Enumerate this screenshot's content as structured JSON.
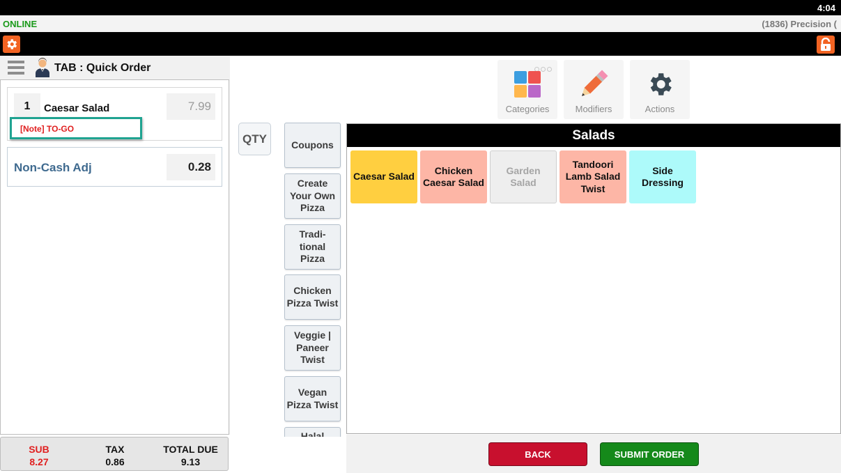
{
  "status_bar": {
    "clock": "4:04"
  },
  "info_bar": {
    "connection": "ONLINE",
    "store": "(1836) Precision ("
  },
  "icons": {
    "settings": "gear-icon",
    "lock": "lock-icon",
    "menu": "hamburger-icon",
    "waiter": "waiter-icon"
  },
  "order": {
    "title": "TAB : Quick Order",
    "items": [
      {
        "qty": "1",
        "name": "Caesar Salad",
        "price": "7.99",
        "note": "[Note] TO-GO"
      }
    ],
    "adjustment": {
      "name": "Non-Cash Adj",
      "amount": "0.28"
    }
  },
  "totals": {
    "sub_label": "SUB",
    "sub_value": "8.27",
    "tax_label": "TAX",
    "tax_value": "0.86",
    "due_label": "TOTAL DUE",
    "due_value": "9.13"
  },
  "qty_label": "QTY",
  "categories": [
    {
      "label": "Coupons"
    },
    {
      "label": "Create Your Own Pizza"
    },
    {
      "label": "Tradi-tional Pizza"
    },
    {
      "label": "Chicken Pizza Twist"
    },
    {
      "label": "Veggie | Paneer Twist"
    },
    {
      "label": "Vegan Pizza Twist"
    },
    {
      "label": "Halal"
    }
  ],
  "mode_tabs": {
    "categories": "Categories",
    "modifiers": "Modifiers",
    "actions": "Actions"
  },
  "menu": {
    "header": "Salads",
    "items": [
      {
        "label": "Caesar Salad",
        "color": "#ffcf40",
        "text_color": "#111111"
      },
      {
        "label": "Chicken Caesar Salad",
        "color": "#fdb6a6",
        "text_color": "#111111"
      },
      {
        "label": "Garden Salad",
        "color": "#eeeeee",
        "text_color": "#a5a5a5"
      },
      {
        "label": "Tandoori Lamb Salad Twist",
        "color": "#fdb6a6",
        "text_color": "#111111"
      },
      {
        "label": "Side Dressing",
        "color": "#adfafa",
        "text_color": "#111111"
      }
    ]
  },
  "buttons": {
    "back": "BACK",
    "submit": "SUBMIT ORDER"
  },
  "colors": {
    "accent_orange": "#f26322",
    "online_green": "#1a9a1a",
    "note_border": "#1fa391",
    "back_red": "#c8102e",
    "submit_green": "#15891a"
  }
}
